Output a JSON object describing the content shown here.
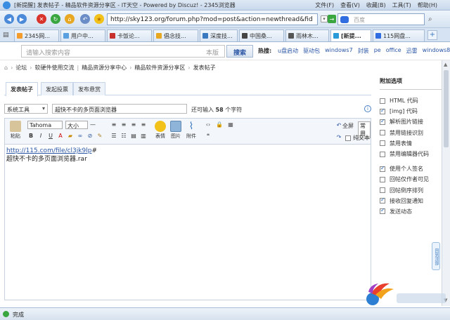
{
  "window": {
    "title": "[新提醒] 发表帖子 - 精品软件资源分享区 - IT天空 - Powered by Discuz! - 2345浏览器",
    "menu": [
      "文件(F)",
      "查看(V)",
      "收藏(B)",
      "工具(T)",
      "帮助(H)"
    ]
  },
  "address": {
    "url": "http://sky123.org/forum.php?mod=post&action=newthread&fid",
    "search_placeholder": "百度"
  },
  "tabs": [
    {
      "label": "2345网..."
    },
    {
      "label": "用户中..."
    },
    {
      "label": "卡饭论..."
    },
    {
      "label": "倡念技..."
    },
    {
      "label": "深度技..."
    },
    {
      "label": "中国桑..."
    },
    {
      "label": "雨林木..."
    },
    {
      "label": "[新提..."
    },
    {
      "label": "115网盘..."
    }
  ],
  "site_search": {
    "placeholder": "请输入搜索内容",
    "scope": "本版",
    "button": "搜索",
    "hot_label": "热搜:",
    "hot": [
      "u盘启动",
      "驱动包",
      "windows7",
      "封装",
      "pe",
      "office",
      "迅雷",
      "windows8",
      "qq"
    ]
  },
  "breadcrumb": [
    "论坛",
    "软硬件使用交流",
    "精品资源分享中心",
    "精品软件资源分享区",
    "发表帖子"
  ],
  "post_tabs": [
    "发表帖子",
    "发起投票",
    "发布悬赏"
  ],
  "form": {
    "type_value": "系统工具",
    "subject": "超快不卡的多页面浏览器",
    "count_prefix": "还可输入",
    "count_value": "58",
    "count_suffix": "个字符"
  },
  "toolbar": {
    "paste": "粘贴",
    "font": "Tahoma",
    "size": "大小",
    "emoticon": "表情",
    "image": "图片",
    "attach": "附件",
    "fullscreen": "全屏",
    "common": "常用",
    "plain_text": "纯文本"
  },
  "editor": {
    "link": "http://115.com/file/cl3jk9lp",
    "link_suffix": "#",
    "line2": "超快不卡的多页面浏览器.rar"
  },
  "options": {
    "title": "附加选项",
    "items": [
      {
        "label": "HTML 代码",
        "checked": false
      },
      {
        "label": "[img] 代码",
        "checked": true
      },
      {
        "label": "解析图片链接",
        "checked": true
      },
      {
        "label": "禁用链接识别",
        "checked": false
      },
      {
        "label": "禁用表情",
        "checked": false
      },
      {
        "label": "禁用编辑器代码",
        "checked": false
      },
      {
        "label": "使用个人签名",
        "checked": true
      },
      {
        "label": "回帖仅作者可见",
        "checked": false
      },
      {
        "label": "回帖倒序排列",
        "checked": false
      },
      {
        "label": "接收回复通知",
        "checked": true
      },
      {
        "label": "发送动态",
        "checked": true
      }
    ],
    "scroll_hint": "回到顶部"
  },
  "status": {
    "text": "完成"
  },
  "colors": {
    "accent": "#2a56a5",
    "tab_active": "#ffffff"
  }
}
